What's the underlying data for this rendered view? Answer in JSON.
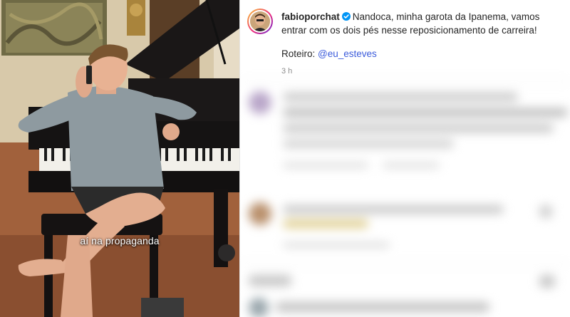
{
  "video": {
    "caption": "aí na propaganda"
  },
  "post": {
    "username": "fabioporchat",
    "caption": "Nandoca, minha garota da Ipanema, vamos entrar com os dois pés nesse reposicionamento de carreira!",
    "script_label": "Roteiro:",
    "script_mention": "@eu_esteves",
    "timestamp": "3 h"
  },
  "colors": {
    "mention": "#3b5bdb",
    "verified": "#0095f6",
    "muted": "#8e8e8e"
  }
}
